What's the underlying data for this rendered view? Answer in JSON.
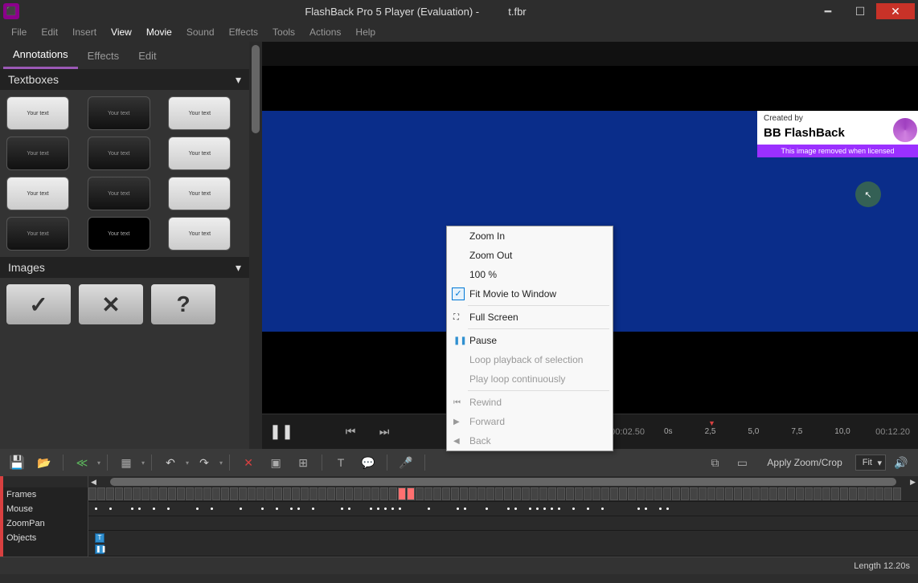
{
  "window": {
    "title": "FlashBack Pro 5 Player (Evaluation) -",
    "filename": "t.fbr"
  },
  "menubar": [
    "File",
    "Edit",
    "Insert",
    "View",
    "Movie",
    "Sound",
    "Effects",
    "Tools",
    "Actions",
    "Help"
  ],
  "menubar_highlighted": [
    "View",
    "Movie"
  ],
  "left_panel": {
    "tabs": [
      "Annotations",
      "Effects",
      "Edit"
    ],
    "active_tab": "Annotations",
    "section_textboxes": "Textboxes",
    "textbox_thumb_label": "Your text",
    "section_images": "Images"
  },
  "watermark": {
    "created_by": "Created by",
    "brand": "BB FlashBack",
    "banner": "This image removed when licensed"
  },
  "context_menu": {
    "items": [
      {
        "label": "Zoom In",
        "sep": false
      },
      {
        "label": "Zoom Out",
        "sep": false
      },
      {
        "label": "100 %",
        "sep": false
      },
      {
        "label": "Fit Movie to Window",
        "checked": true,
        "sep_after": true
      },
      {
        "label": "Full Screen",
        "icon": "⛶",
        "sep_after": true
      },
      {
        "label": "Pause",
        "icon": "❚❚",
        "icon_color": "#3090d0"
      },
      {
        "label": "Loop playback of selection",
        "disabled": true
      },
      {
        "label": "Play loop continuously",
        "disabled": true,
        "sep_after": true
      },
      {
        "label": "Rewind",
        "disabled": true,
        "icon": "⏮"
      },
      {
        "label": "Forward",
        "disabled": true,
        "icon": "▶"
      },
      {
        "label": "Back",
        "disabled": true,
        "icon": "◀"
      }
    ]
  },
  "playback": {
    "current_time": "00:02.50",
    "total_time": "00:12.20",
    "ruler": [
      "0s",
      "2,5",
      "5,0",
      "7,5",
      "10,0"
    ]
  },
  "toolbar": {
    "apply_zoom_crop": "Apply Zoom/Crop",
    "fit": "Fit"
  },
  "tracks": {
    "labels": [
      "Frames",
      "Mouse",
      "ZoomPan",
      "Objects"
    ]
  },
  "statusbar": {
    "length_label": "Length",
    "length_value": "12.20s"
  }
}
